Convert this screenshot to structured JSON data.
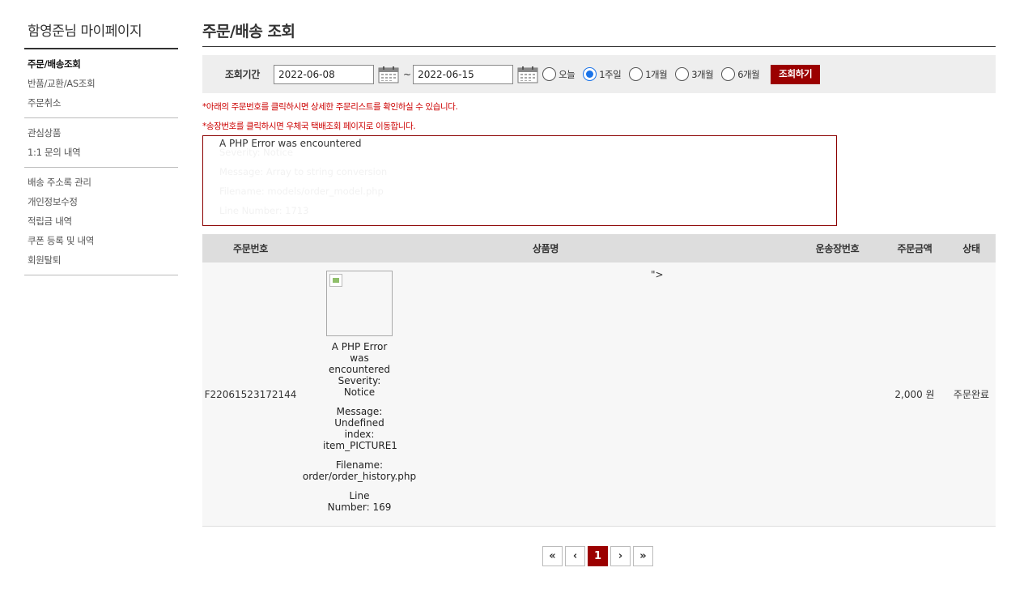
{
  "sidebar": {
    "title": "함영준님 마이페이지",
    "groups": [
      [
        {
          "label": "주문/배송조회",
          "active": true
        },
        {
          "label": "반품/교환/AS조회"
        },
        {
          "label": "주문취소"
        }
      ],
      [
        {
          "label": "관심상품"
        },
        {
          "label": "1:1 문의 내역"
        }
      ],
      [
        {
          "label": "배송 주소록 관리"
        },
        {
          "label": "개인정보수정"
        },
        {
          "label": "적립금 내역"
        },
        {
          "label": "쿠폰 등록 및 내역"
        },
        {
          "label": "회원탈퇴"
        }
      ]
    ]
  },
  "main": {
    "title": "주문/배송 조회",
    "search": {
      "label": "조회기간",
      "start_date": "2022-06-08",
      "separator": "~",
      "end_date": "2022-06-15",
      "periods": [
        "오늘",
        "1주일",
        "1개월",
        "3개월",
        "6개월"
      ],
      "selected_period": "1주일",
      "button": "조회하기"
    },
    "notices": [
      "*아래의 주문번호를 클릭하시면 상세한 주문리스트를 확인하실 수 있습니다.",
      "*송장번호를 클릭하시면 우체국 택배조회 페이지로 이동합니다."
    ],
    "error_box": {
      "title": "A PHP Error was encountered",
      "lines": [
        "Severity: Notice",
        "Message: Array to string conversion",
        "Filename: models/order_model.php",
        "Line Number: 1713"
      ]
    },
    "table": {
      "headers": [
        "주문번호",
        "상품명",
        "운송장번호",
        "주문금액",
        "상태"
      ],
      "rows": [
        {
          "order_no": "F22061523172144",
          "product_error": [
            "A PHP Error was encountered\nSeverity: Notice",
            "Message: Undefined index: item_PICTURE1",
            "Filename: order/order_history.php",
            "Line Number: 169"
          ],
          "stray_text": "\">",
          "tracking_no": "",
          "amount": "2,000 원",
          "status": "주문완료"
        }
      ]
    },
    "pagination": {
      "first": "«",
      "prev": "‹",
      "current": "1",
      "next": "›",
      "last": "»"
    }
  },
  "colors": {
    "accent": "#9b0000",
    "notice": "#cc0000",
    "radio_checked": "#1a73e8"
  }
}
